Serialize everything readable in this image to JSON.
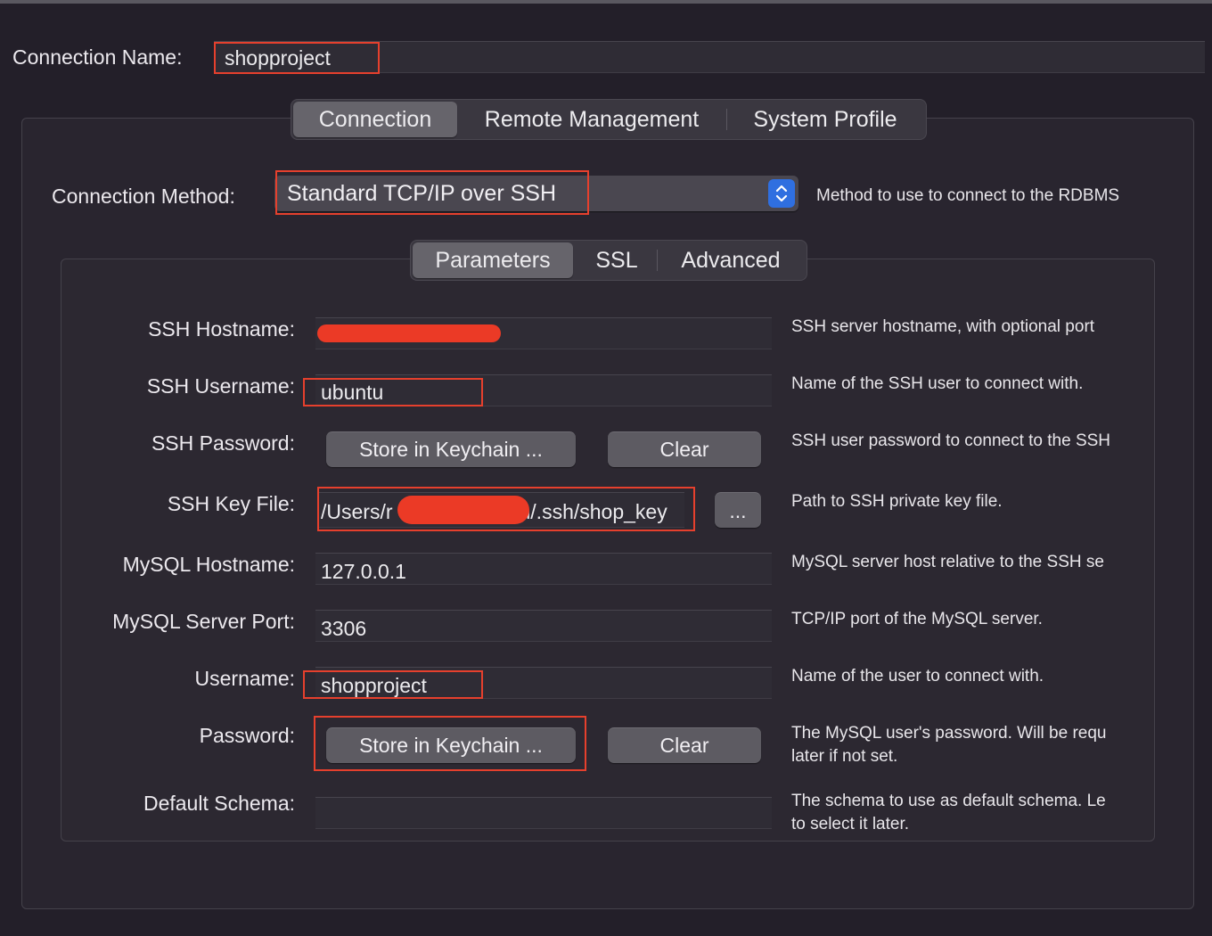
{
  "connection_name": {
    "label": "Connection Name:",
    "value": "shopproject"
  },
  "main_tabs": [
    {
      "label": "Connection",
      "active": true
    },
    {
      "label": "Remote Management",
      "active": false
    },
    {
      "label": "System Profile",
      "active": false
    }
  ],
  "connection_method": {
    "label": "Connection Method:",
    "value": "Standard TCP/IP over SSH",
    "description": "Method to use to connect to the RDBMS"
  },
  "sub_tabs": [
    {
      "label": "Parameters",
      "active": true
    },
    {
      "label": "SSL",
      "active": false
    },
    {
      "label": "Advanced",
      "active": false
    }
  ],
  "params": {
    "ssh_hostname": {
      "label": "SSH Hostname:",
      "value": "",
      "description": "SSH server hostname, with  optional port"
    },
    "ssh_username": {
      "label": "SSH Username:",
      "value": "ubuntu",
      "description": "Name of the SSH user to connect with."
    },
    "ssh_password": {
      "label": "SSH Password:",
      "store_label": "Store in Keychain ...",
      "clear_label": "Clear",
      "description": "SSH user password to connect to the SSH"
    },
    "ssh_key_file": {
      "label": "SSH Key File:",
      "value_prefix": "/Users/r",
      "value_suffix": "n/.ssh/shop_key",
      "browse_label": "...",
      "description": "Path to SSH private key file."
    },
    "mysql_hostname": {
      "label": "MySQL Hostname:",
      "value": "127.0.0.1",
      "description": "MySQL server host relative to the SSH se"
    },
    "mysql_port": {
      "label": "MySQL Server Port:",
      "value": "3306",
      "description": "TCP/IP port of the MySQL server."
    },
    "username": {
      "label": "Username:",
      "value": "shopproject",
      "description": "Name of the user to connect with."
    },
    "password": {
      "label": "Password:",
      "store_label": "Store in Keychain ...",
      "clear_label": "Clear",
      "description_line1": "The MySQL user's password. Will be requ",
      "description_line2": "later if not set."
    },
    "default_schema": {
      "label": "Default Schema:",
      "value": "",
      "description_line1": "The schema to use as default schema. Le",
      "description_line2": "to select it later."
    }
  },
  "colors": {
    "background": "#231f29",
    "annotation_red": "#e6402d",
    "select_stepper_blue": "#2f6fe0"
  }
}
